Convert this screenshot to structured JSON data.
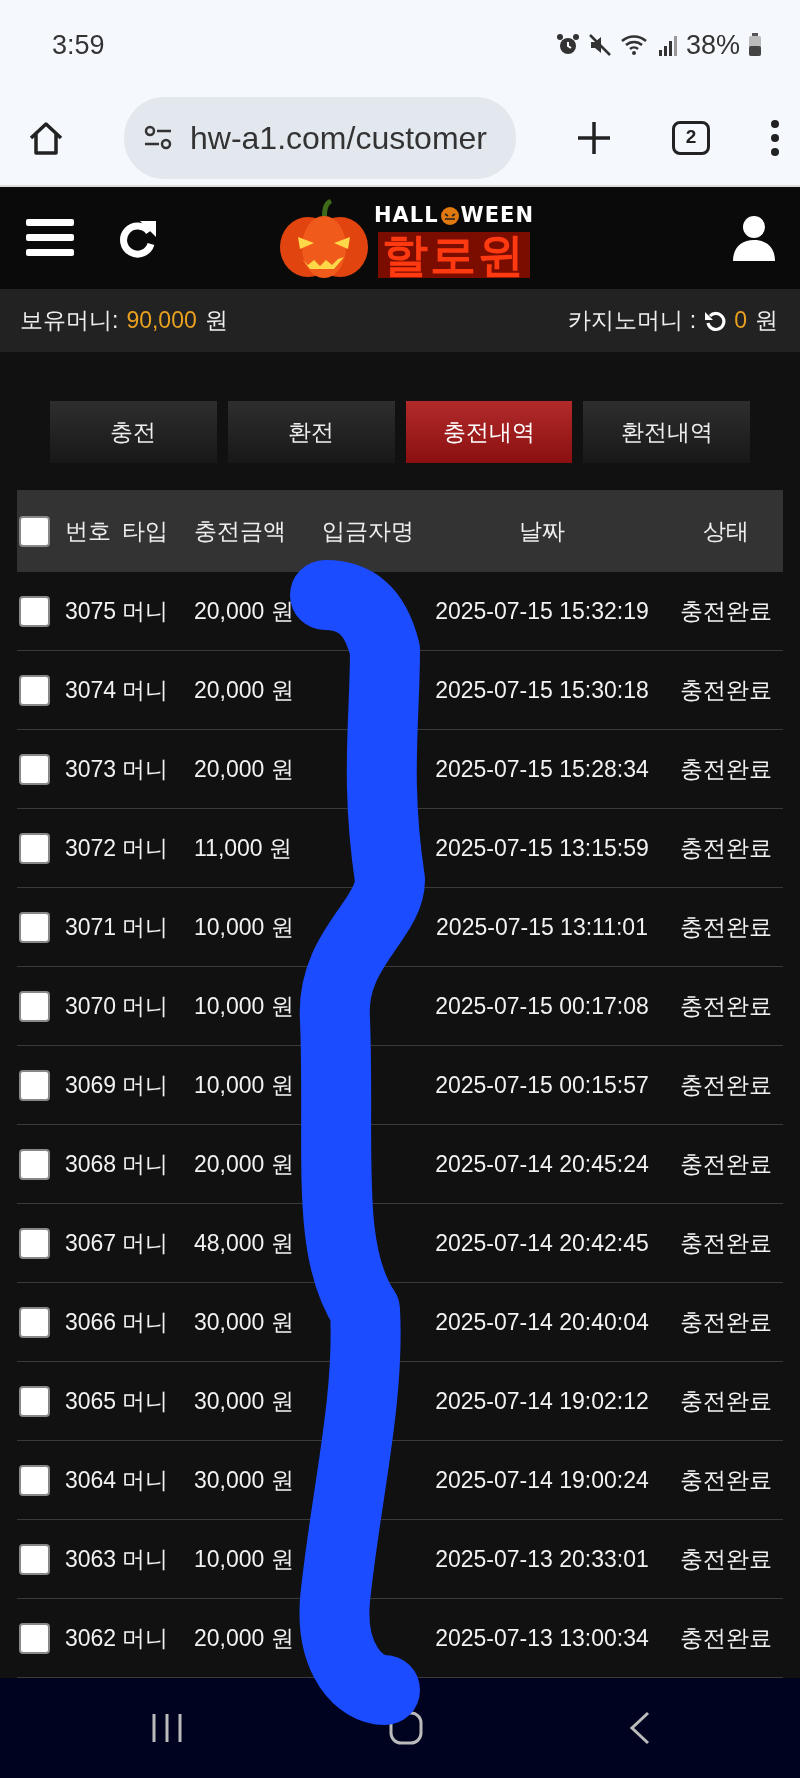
{
  "status_bar": {
    "time": "3:59",
    "battery": "38%"
  },
  "browser": {
    "url": "hw-a1.com/customer",
    "tab_count": "2"
  },
  "logo": {
    "top_left": "HALL",
    "top_right": "WEEN",
    "main": "할로윈"
  },
  "balance": {
    "label": "보유머니:",
    "amount": "90,000",
    "unit": "원",
    "casino_label": "카지노머니 :",
    "casino_amount": "0",
    "casino_unit": "원"
  },
  "tabs": [
    {
      "label": "충전",
      "selected": false
    },
    {
      "label": "환전",
      "selected": false
    },
    {
      "label": "충전내역",
      "selected": true
    },
    {
      "label": "환전내역",
      "selected": false
    }
  ],
  "table": {
    "select_all_checked": false,
    "columns": [
      "번호",
      "타입",
      "충전금액",
      "입금자명",
      "날짜",
      "상태"
    ],
    "rows": [
      {
        "checked": false,
        "number": "3075",
        "type": "머니",
        "amount": "20,000 원",
        "date": "2025-07-15 15:32:19",
        "status": "충전완료"
      },
      {
        "checked": false,
        "number": "3074",
        "type": "머니",
        "amount": "20,000 원",
        "date": "2025-07-15 15:30:18",
        "status": "충전완료"
      },
      {
        "checked": false,
        "number": "3073",
        "type": "머니",
        "amount": "20,000 원",
        "date": "2025-07-15 15:28:34",
        "status": "충전완료"
      },
      {
        "checked": false,
        "number": "3072",
        "type": "머니",
        "amount": "11,000 원",
        "date": "2025-07-15 13:15:59",
        "status": "충전완료"
      },
      {
        "checked": false,
        "number": "3071",
        "type": "머니",
        "amount": "10,000 원",
        "date": "2025-07-15 13:11:01",
        "status": "충전완료"
      },
      {
        "checked": false,
        "number": "3070",
        "type": "머니",
        "amount": "10,000 원",
        "date": "2025-07-15 00:17:08",
        "status": "충전완료"
      },
      {
        "checked": false,
        "number": "3069",
        "type": "머니",
        "amount": "10,000 원",
        "date": "2025-07-15 00:15:57",
        "status": "충전완료"
      },
      {
        "checked": false,
        "number": "3068",
        "type": "머니",
        "amount": "20,000 원",
        "date": "2025-07-14 20:45:24",
        "status": "충전완료"
      },
      {
        "checked": false,
        "number": "3067",
        "type": "머니",
        "amount": "48,000 원",
        "date": "2025-07-14 20:42:45",
        "status": "충전완료"
      },
      {
        "checked": false,
        "number": "3066",
        "type": "머니",
        "amount": "30,000 원",
        "date": "2025-07-14 20:40:04",
        "status": "충전완료"
      },
      {
        "checked": false,
        "number": "3065",
        "type": "머니",
        "amount": "30,000 원",
        "date": "2025-07-14 19:02:12",
        "status": "충전완료"
      },
      {
        "checked": false,
        "number": "3064",
        "type": "머니",
        "amount": "30,000 원",
        "date": "2025-07-14 19:00:24",
        "status": "충전완료"
      },
      {
        "checked": false,
        "number": "3063",
        "type": "머니",
        "amount": "10,000 원",
        "date": "2025-07-13 20:33:01",
        "status": "충전완료"
      },
      {
        "checked": false,
        "number": "3062",
        "type": "머니",
        "amount": "20,000 원",
        "date": "2025-07-13 13:00:34",
        "status": "충전완료"
      }
    ]
  }
}
